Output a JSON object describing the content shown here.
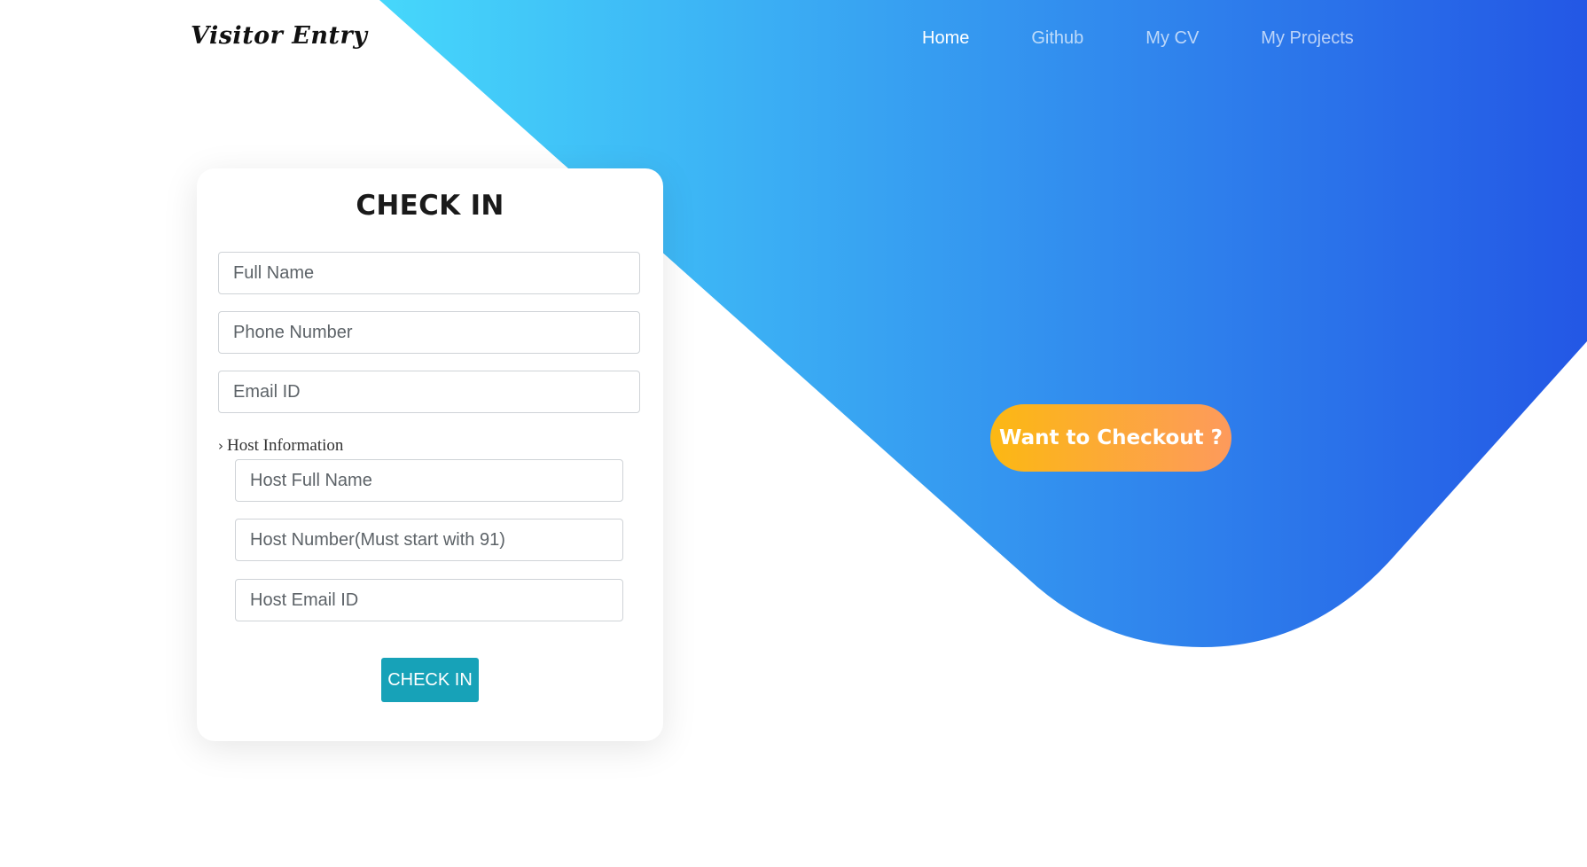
{
  "brand": {
    "logo_text": "Visitor Entry"
  },
  "nav": {
    "items": [
      {
        "label": "Home",
        "active": true
      },
      {
        "label": "Github",
        "active": false
      },
      {
        "label": "My CV",
        "active": false
      },
      {
        "label": "My Projects",
        "active": false
      }
    ]
  },
  "form": {
    "title": "CHECK IN",
    "full_name_placeholder": "Full Name",
    "phone_placeholder": "Phone Number",
    "email_placeholder": "Email ID",
    "host_section_label": "Host Information",
    "host_name_placeholder": "Host Full Name",
    "host_number_placeholder": "Host Number(Must start with 91)",
    "host_email_placeholder": "Host Email ID",
    "submit_label": "CHECK IN"
  },
  "hero": {
    "checkout_label": "Want to Checkout ?"
  },
  "colors": {
    "gradient_start": "#46d7fb",
    "gradient_end": "#2357e5",
    "checkout_start": "#fcb813",
    "checkout_end": "#fd9a5c",
    "submit": "#17a2b8"
  },
  "icons": {
    "host_toggle": "chevron-right-icon"
  }
}
